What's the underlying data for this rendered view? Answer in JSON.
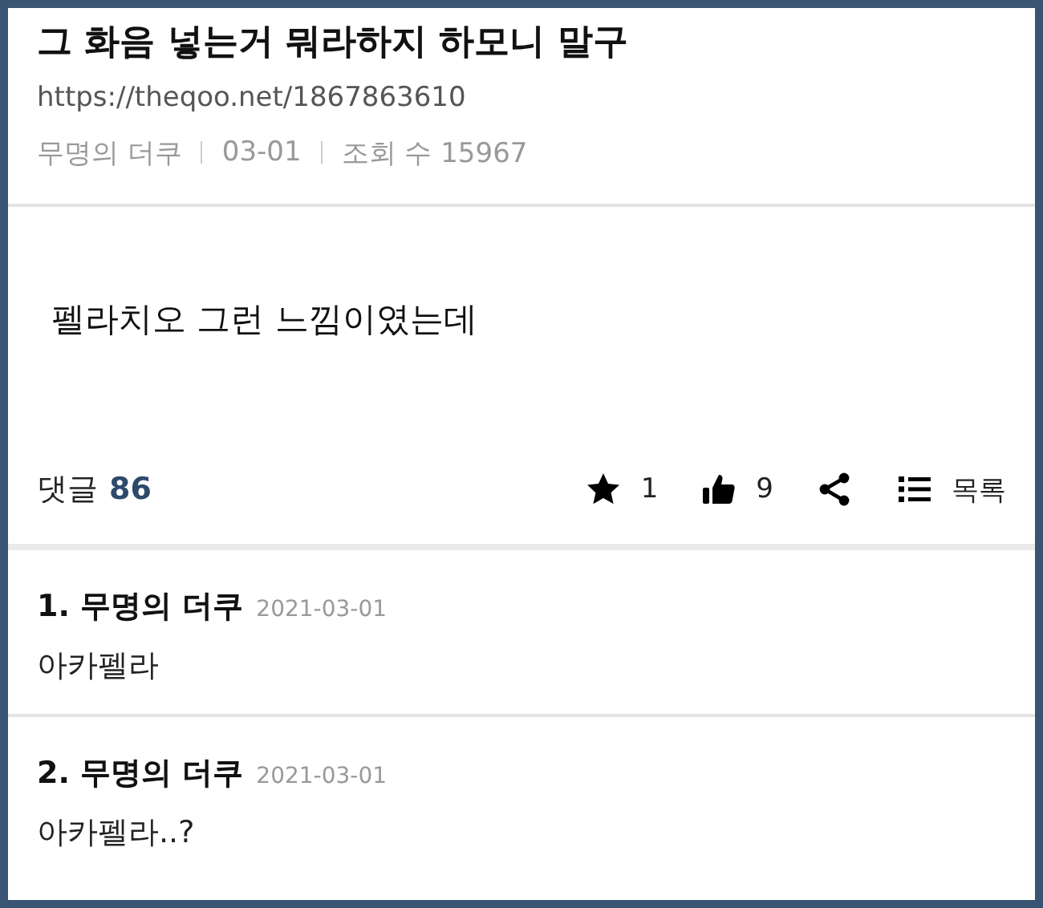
{
  "post": {
    "title": "그 화음 넣는거 뭐라하지 하모니 말구",
    "url": "https://theqoo.net/1867863610",
    "meta": [
      "무명의 더쿠",
      "03-01",
      "조회 수 15967"
    ],
    "body": "펠라치오 그런 느낌이였는데"
  },
  "footer": {
    "comments_label": "댓글",
    "comments_count": "86",
    "actions": [
      {
        "kind": "star",
        "count": "1"
      },
      {
        "kind": "like",
        "count": "9"
      },
      {
        "kind": "share"
      },
      {
        "kind": "list",
        "label": "목록"
      }
    ]
  },
  "comments": [
    {
      "author": "1. 무명의 더쿠",
      "date": "2021-03-01",
      "text": "아카펠라"
    },
    {
      "author": "2. 무명의 더쿠",
      "date": "2021-03-01",
      "text": "아카펠라..?"
    }
  ]
}
